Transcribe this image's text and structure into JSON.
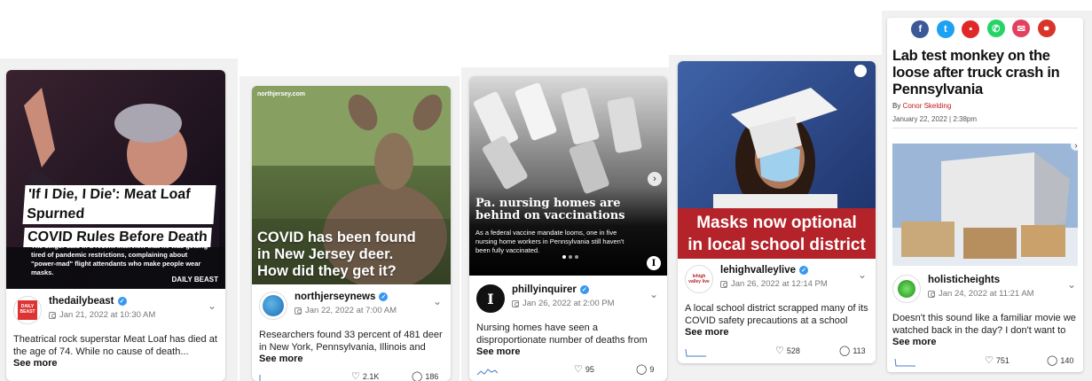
{
  "cards": [
    {
      "media": {
        "headline_line1": "'If I Die, I Die': Meat Loaf Spurned",
        "headline_line2": "COVID Rules Before Death",
        "subtext": "The singer said in a recent interview that he was getting tired of pandemic restrictions, complaining about \"power-mad\" flight attendants who make people wear masks.",
        "brand": "DAILY BEAST"
      },
      "username": "thedailybeast",
      "avatar_text": "DAILY BEAST",
      "date": "Jan 21, 2022 at 10:30 AM",
      "text": "Theatrical rock superstar Meat Loaf has died at the age of 74.   While no cause of death...",
      "see_more": "See more",
      "likes": "",
      "comments": ""
    },
    {
      "media": {
        "site": "northjersey.com",
        "headline": "COVID has been found in New Jersey deer. How did they get it?"
      },
      "username": "northjerseynews",
      "date": "Jan 22, 2022 at 7:00 AM",
      "text": "Researchers found 33 percent of 481 deer in New York, Pennsylvania, Illinois and Michiga...",
      "see_more": "See more",
      "likes": "2.1K",
      "comments": "186"
    },
    {
      "media": {
        "headline": "Pa. nursing homes are behind on vaccinations",
        "subtext": "As a federal vaccine mandate looms, one in five nursing home workers in Pennsylvania still haven't been fully vaccinated.",
        "badge": "I"
      },
      "username": "phillyinquirer",
      "date": "Jan 26, 2022 at 2:00 PM",
      "text": "Nursing homes have seen a disproportionate number of deaths from the very beginning ...",
      "see_more": "See more",
      "likes": "95",
      "comments": "9"
    },
    {
      "media": {
        "headline_line1": "Masks now optional",
        "headline_line2": "in local school district"
      },
      "username": "lehighvalleylive",
      "avatar_text": "lehigh valley live",
      "date": "Jan 26, 2022 at 12:14 PM",
      "text": "A local school district scrapped many of its COVID safety precautions at a school board...",
      "see_more": "See more",
      "likes": "528",
      "comments": "113"
    },
    {
      "article": {
        "headline": "Lab test monkey on the loose after truck crash in Pennsylvania",
        "by_label": "By",
        "author": "Conor Skelding",
        "date": "January 22, 2022 | 2:38pm"
      },
      "username": "holisticheights",
      "date": "Jan 24, 2022 at 11:21 AM",
      "text": "Doesn't this sound like a familiar movie we watched back in the day? I don't want to se...",
      "see_more": "See more",
      "likes": "751",
      "comments": "140"
    }
  ],
  "share_icons": [
    "facebook-icon",
    "twitter-icon",
    "flipboard-icon",
    "whatsapp-icon",
    "email-icon",
    "link-icon"
  ],
  "colors": {
    "verified": "#3897f0",
    "mask_banner": "#b5232a",
    "facebook": "#3b5998",
    "twitter": "#1da1f2",
    "flipboard": "#e12828",
    "whatsapp": "#25d366",
    "email": "#e4405f",
    "link": "#d9342b",
    "author_link": "#c4161c"
  }
}
